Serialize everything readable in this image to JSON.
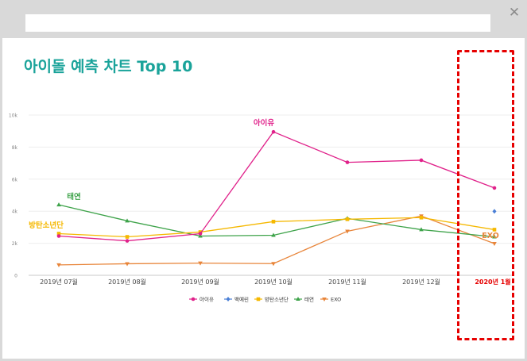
{
  "dialog": {
    "close_label": "✕",
    "title": "아이돌 예측 차트 Top 10"
  },
  "chart_data": {
    "type": "line",
    "title": "아이돌 예측 차트 Top 10",
    "categories": [
      "2019년 07월",
      "2019년 08월",
      "2019년 09월",
      "2019년 10월",
      "2019년 11월",
      "2019년 12월",
      "2020년 1월"
    ],
    "highlight_category": "2020년 1월",
    "y_ticks": [
      "0",
      "2k",
      "4k",
      "6k",
      "8k",
      "10k"
    ],
    "ylim": [
      0,
      10000
    ],
    "grid": true,
    "legend_position": "bottom",
    "series": [
      {
        "name": "아이유",
        "color": "#e0218a",
        "marker": "circle",
        "label": "아이유",
        "values": [
          2450,
          2150,
          2600,
          8950,
          7050,
          7180,
          5450
        ]
      },
      {
        "name": "백예린",
        "color": "#4a7fd6",
        "marker": "diamond",
        "values": [
          null,
          null,
          null,
          null,
          null,
          null,
          3990
        ]
      },
      {
        "name": "방탄소년단",
        "color": "#f5b800",
        "marker": "square",
        "label": "방탄소년단",
        "values": [
          2600,
          2400,
          2700,
          3350,
          3500,
          3600,
          2850
        ]
      },
      {
        "name": "태연",
        "color": "#3ea34a",
        "marker": "triangle-up",
        "label": "태연",
        "values": [
          4400,
          3400,
          2450,
          2500,
          3550,
          2850,
          2400
        ]
      },
      {
        "name": "EXO",
        "color": "#e8853a",
        "marker": "triangle-down",
        "label": "EXO",
        "values": [
          650,
          720,
          760,
          730,
          2750,
          3700,
          1980
        ]
      }
    ]
  }
}
